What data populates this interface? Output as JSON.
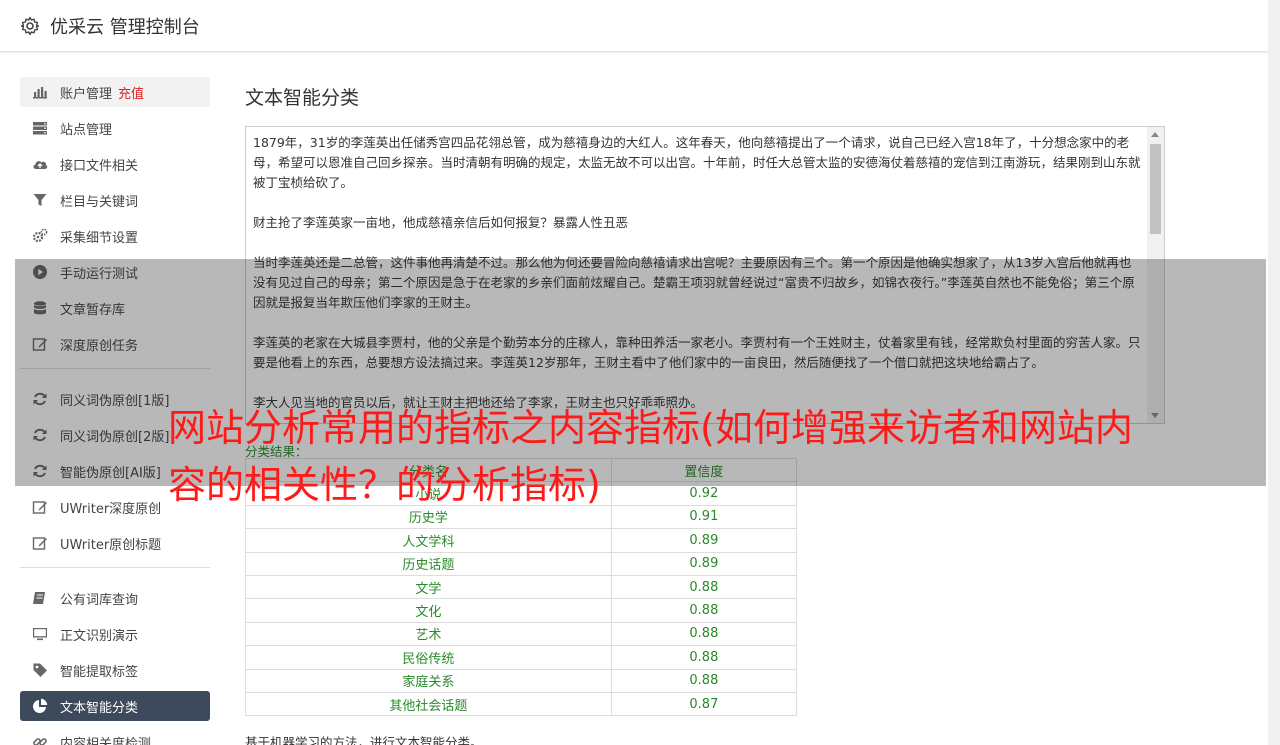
{
  "header": {
    "title": "优采云 管理控制台",
    "icon": "gear-icon"
  },
  "sidebar": {
    "items": [
      {
        "label": "账户管理",
        "badge": "充值",
        "icon": "bar-chart-icon",
        "highlight": true
      },
      {
        "label": "站点管理",
        "icon": "server-icon"
      },
      {
        "label": "接口文件相关",
        "icon": "cloud-upload-icon"
      },
      {
        "label": "栏目与关键词",
        "icon": "filter-icon"
      },
      {
        "label": "采集细节设置",
        "icon": "cogs-icon"
      },
      {
        "label": "手动运行测试",
        "icon": "play-icon"
      },
      {
        "label": "文章暂存库",
        "icon": "database-icon"
      },
      {
        "label": "深度原创任务",
        "icon": "edit-icon"
      },
      {
        "label": "同义词伪原创[1版]",
        "icon": "refresh-icon"
      },
      {
        "label": "同义词伪原创[2版]",
        "icon": "refresh-icon"
      },
      {
        "label": "智能伪原创[AI版]",
        "icon": "refresh-icon"
      },
      {
        "label": "UWriter深度原创",
        "icon": "edit-icon"
      },
      {
        "label": "UWriter原创标题",
        "icon": "edit-icon"
      },
      {
        "label": "公有词库查询",
        "icon": "book-icon"
      },
      {
        "label": "正文识别演示",
        "icon": "monitor-icon"
      },
      {
        "label": "智能提取标签",
        "icon": "tag-icon"
      },
      {
        "label": "文本智能分类",
        "icon": "pie-chart-icon",
        "active": true
      },
      {
        "label": "内容相关度检测",
        "icon": "link-icon"
      }
    ]
  },
  "main": {
    "title": "文本智能分类",
    "text_paragraphs": [
      "1879年，31岁的李莲英出任储秀宫四品花翎总管，成为慈禧身边的大红人。这年春天，他向慈禧提出了一个请求，说自己已经入宫18年了，十分想念家中的老母，希望可以恩准自己回乡探亲。当时清朝有明确的规定，太监无故不可以出宫。十年前，时任大总管太监的安德海仗着慈禧的宠信到江南游玩，结果刚到山东就被丁宝桢给砍了。",
      "财主抢了李莲英家一亩地，他成慈禧亲信后如何报复？暴露人性丑恶",
      "当时李莲英还是二总管，这件事他再清楚不过。那么他为何还要冒险向慈禧请求出宫呢？主要原因有三个。第一个原因是他确实想家了，从13岁入宫后他就再也没有见过自己的母亲；第二个原因是急于在老家的乡亲们面前炫耀自己。楚霸王项羽就曾经说过“富贵不归故乡，如锦衣夜行。”李莲英自然也不能免俗；第三个原因就是报复当年欺压他们李家的王财主。",
      "李莲英的老家在大城县李贾村，他的父亲是个勤劳本分的庄稼人，靠种田养活一家老小。李贾村有一个王姓财主，仗着家里有钱，经常欺负村里面的穷苦人家。只要是他看上的东西，总要想方设法搞过来。李莲英12岁那年，王财主看中了他们家中的一亩良田，然后随便找了一个借口就把这块地给霸占了。",
      "李大人见当地的官员以后，就让王财主把地还给了李家，王财主也只好乖乖照办。"
    ],
    "result_label": "分类结果：",
    "table": {
      "headers": [
        "分类名",
        "置信度"
      ],
      "rows": [
        [
          "小说",
          "0.92"
        ],
        [
          "历史学",
          "0.91"
        ],
        [
          "人文学科",
          "0.89"
        ],
        [
          "历史话题",
          "0.89"
        ],
        [
          "文学",
          "0.88"
        ],
        [
          "文化",
          "0.88"
        ],
        [
          "艺术",
          "0.88"
        ],
        [
          "民俗传统",
          "0.88"
        ],
        [
          "家庭关系",
          "0.88"
        ],
        [
          "其他社会话题",
          "0.87"
        ]
      ]
    },
    "footnote": "基于机器学习的方法，进行文本智能分类。"
  },
  "overlay": {
    "title": "网站分析常用的指标之内容指标(如何增强来访者和网站内容的相关性？的分析指标)"
  },
  "colors": {
    "active_nav": "#3c4a5c",
    "result_green": "#2a8a2a",
    "badge_red": "#e02020",
    "overlay_text": "#ff1a1a"
  }
}
